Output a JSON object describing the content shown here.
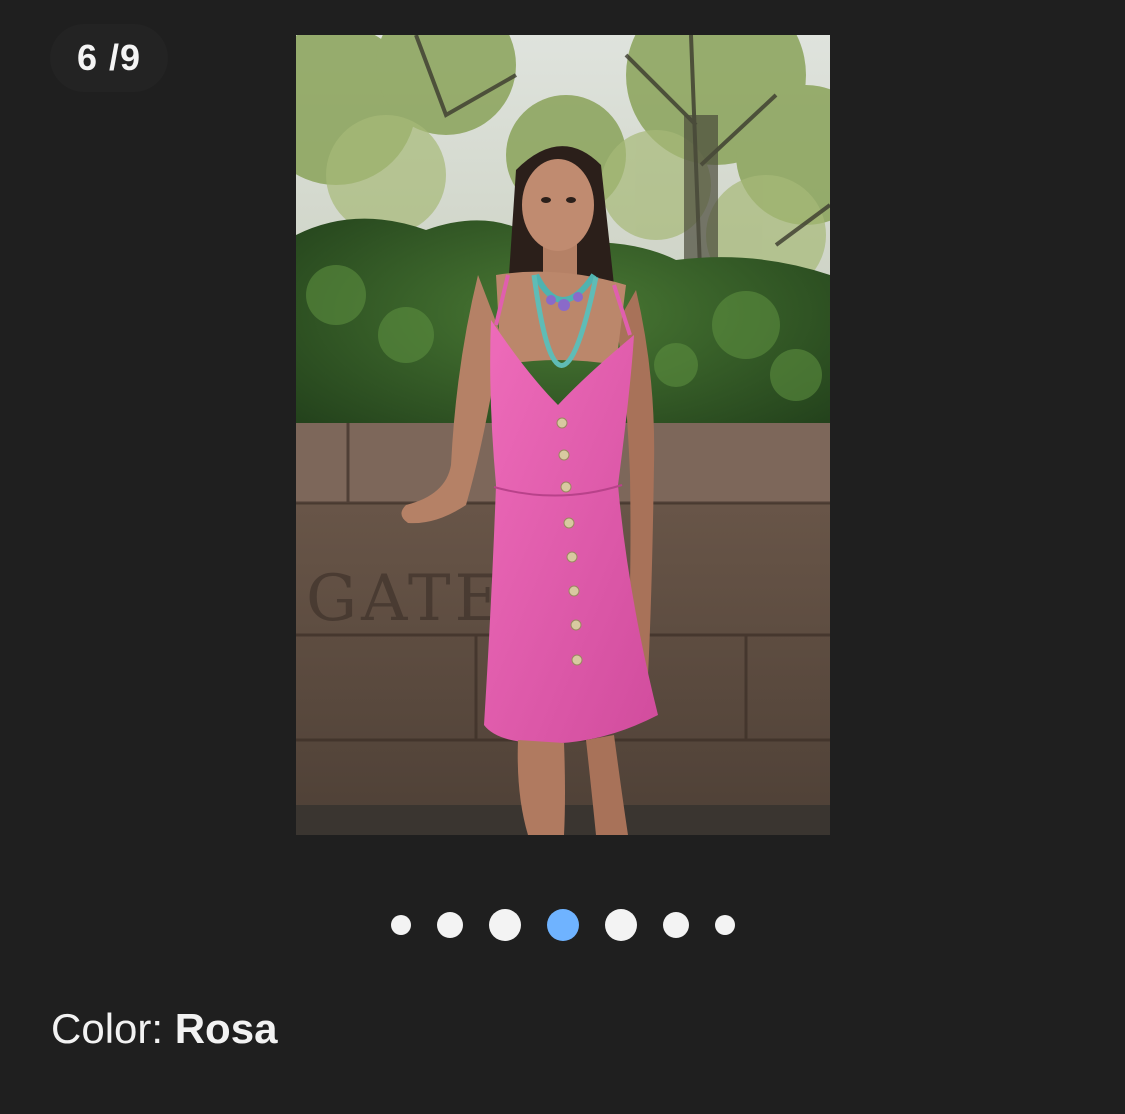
{
  "gallery": {
    "counter_text": "6 /9",
    "current_index": 6,
    "total_images": 9,
    "image_alt": "Modelo con vestido rosa",
    "engraved_text": "GATE"
  },
  "pagination": {
    "dots": [
      {
        "active": false
      },
      {
        "active": false
      },
      {
        "active": false
      },
      {
        "active": true
      },
      {
        "active": false
      },
      {
        "active": false
      },
      {
        "active": false
      }
    ],
    "active_color": "#6fb3ff",
    "inactive_color": "#f3f3f3"
  },
  "product": {
    "color_label": "Color:",
    "color_value": "Rosa"
  },
  "theme": {
    "background": "#1f1f1f",
    "text": "#f2f2f2",
    "dress_color": "#e05fae"
  }
}
